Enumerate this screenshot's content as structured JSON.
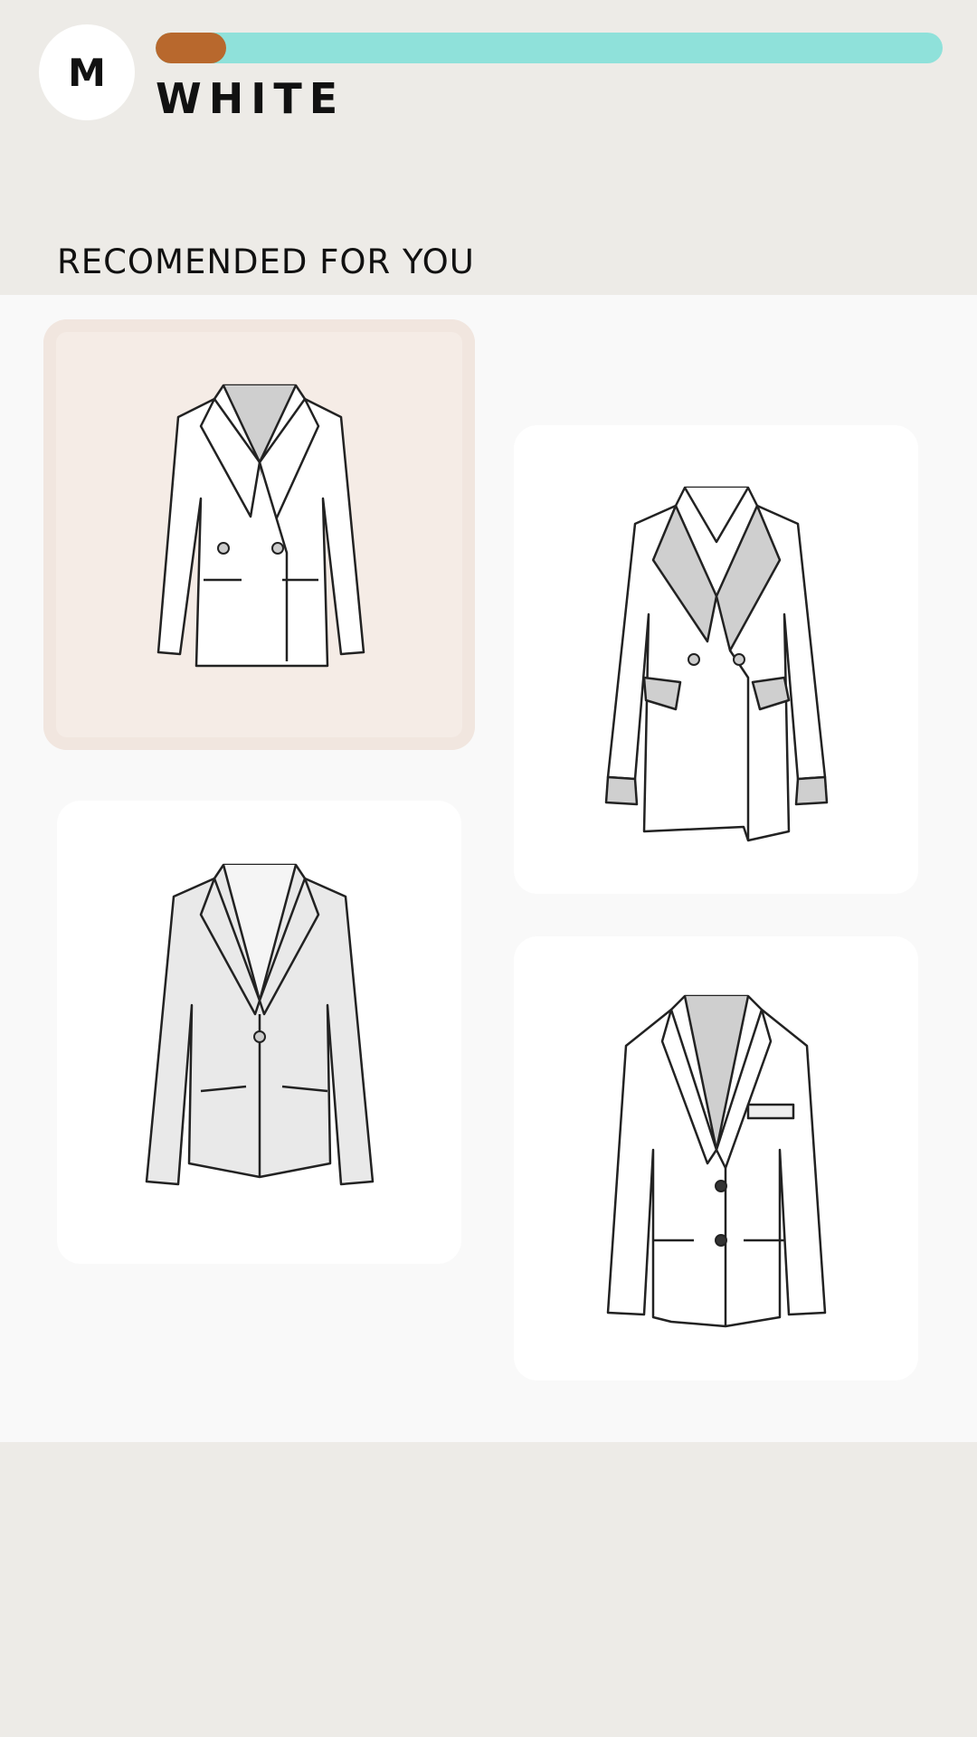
{
  "profile": {
    "avatar_initial": "M"
  },
  "progress": {
    "fraction": 0.09,
    "fill_color": "#b8682d",
    "track_color": "#8fe1da"
  },
  "selection": {
    "color_name": "WHITE"
  },
  "recommendations": {
    "title": "RECOMENDED FOR YOU",
    "items": [
      {
        "icon": "double-breasted-blazer-icon",
        "selected": true
      },
      {
        "icon": "double-breasted-long-coat-icon",
        "selected": false
      },
      {
        "icon": "single-button-blazer-icon",
        "selected": false
      },
      {
        "icon": "two-button-blazer-icon",
        "selected": false
      }
    ]
  }
}
